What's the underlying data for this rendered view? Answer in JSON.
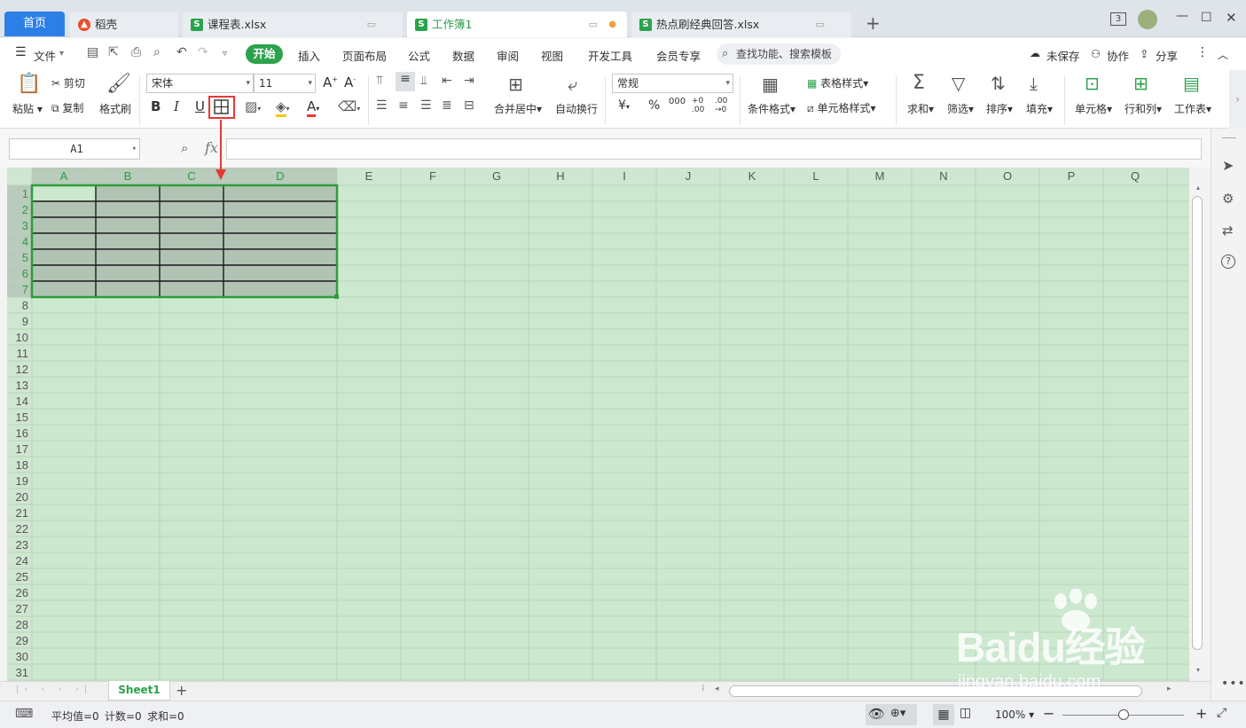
{
  "tabs": {
    "home": "首页",
    "items": [
      {
        "label": "稻壳",
        "icon": "docer-icon"
      },
      {
        "label": "课程表.xlsx",
        "icon": "sheet-icon"
      },
      {
        "label": "工作簿1",
        "icon": "sheet-icon"
      },
      {
        "label": "热点刷经典回答.xlsx",
        "icon": "sheet-icon"
      }
    ],
    "window_badge": "3"
  },
  "menu": {
    "file": "文件",
    "start": "开始",
    "items": [
      "插入",
      "页面布局",
      "公式",
      "数据",
      "审阅",
      "视图",
      "开发工具",
      "会员专享"
    ],
    "search": "查找功能、搜索模板",
    "unsaved": "未保存",
    "collab": "协作",
    "share": "分享"
  },
  "ribbon": {
    "paste": "粘贴",
    "cut": "剪切",
    "copy": "复制",
    "format_painter": "格式刷",
    "font_name": "宋体",
    "font_size": "11",
    "merge_center": "合并居中",
    "auto_wrap": "自动换行",
    "number_format": "常规",
    "cond_format": "条件格式",
    "table_style": "表格样式",
    "cell_style": "单元格样式",
    "sum": "求和",
    "filter": "筛选",
    "sort": "排序",
    "fill": "填充",
    "cell": "单元格",
    "row_col": "行和列",
    "worksheet": "工作表"
  },
  "formula": {
    "name_box": "A1",
    "fx": "fx",
    "value": ""
  },
  "grid": {
    "columns": [
      "A",
      "B",
      "C",
      "D",
      "E",
      "F",
      "G",
      "H",
      "I",
      "J",
      "K",
      "L",
      "M",
      "N",
      "O",
      "P",
      "Q"
    ],
    "rows": [
      "1",
      "2",
      "3",
      "4",
      "5",
      "6",
      "7",
      "8",
      "9",
      "10",
      "11",
      "12",
      "13",
      "14",
      "15",
      "16",
      "17",
      "18",
      "19",
      "20",
      "21",
      "22",
      "23",
      "24",
      "25",
      "26",
      "27",
      "28",
      "29",
      "30",
      "31"
    ],
    "selected_range": "A1:D7",
    "bg_color": "#cce8cf",
    "selection_color": "#2e9c3e"
  },
  "sheets": {
    "active": "Sheet1"
  },
  "status": {
    "average": "平均值=0",
    "count": "计数=0",
    "sum": "求和=0",
    "zoom": "100%"
  },
  "watermark": {
    "brand": "Baidu经验",
    "url": "jingyan.baidu.com"
  },
  "colors": {
    "accent_green": "#2ca24c",
    "home_blue": "#2d7fe8",
    "annotation_red": "#e53935"
  }
}
